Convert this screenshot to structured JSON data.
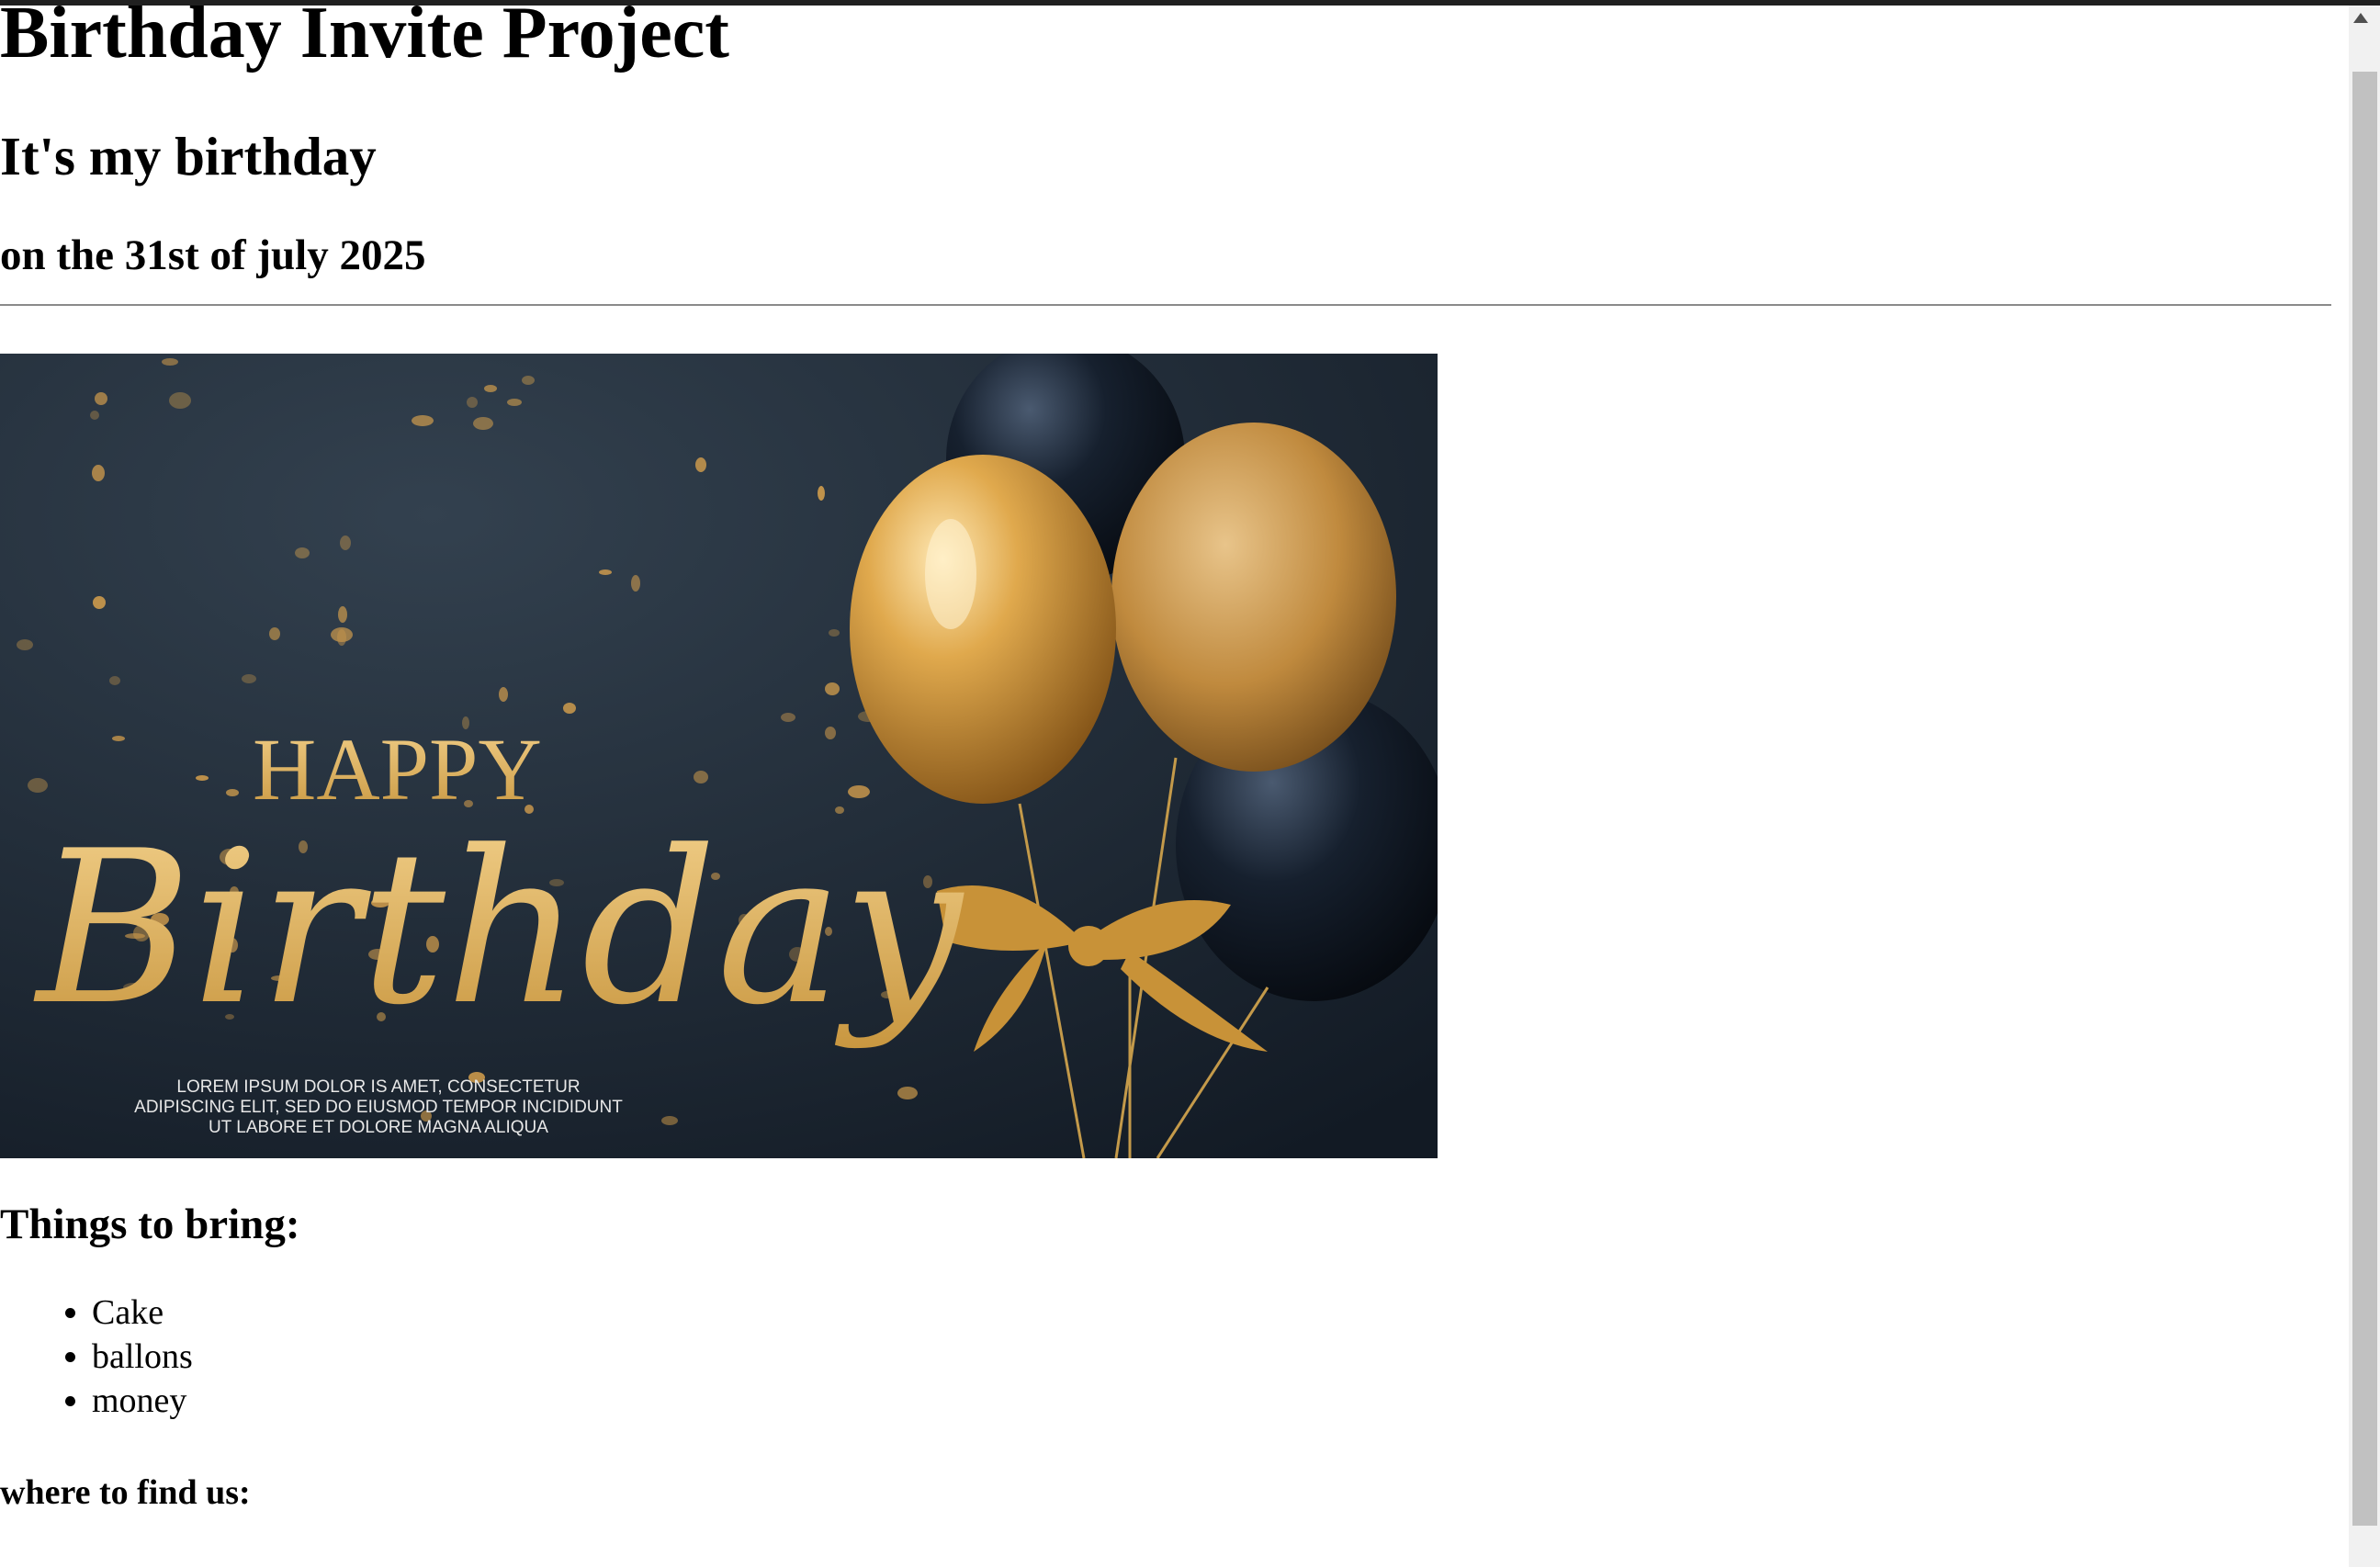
{
  "page": {
    "title": "Birthday Invite Project",
    "subtitle": "It's my birthday",
    "date_line": "on the 31st of july 2025"
  },
  "hero_image": {
    "happy_text": "HAPPY",
    "birthday_text": "Birthday",
    "caption_lines": [
      "LOREM IPSUM DOLOR IS AMET, CONSECTETUR",
      "ADIPISCING ELIT, SED DO EIUSMOD TEMPOR INCIDIDUNT",
      "UT LABORE ET DOLORE MAGNA ALIQUA"
    ]
  },
  "bring": {
    "heading": "Things to bring:",
    "items": [
      "Cake",
      "ballons",
      "money"
    ]
  },
  "location": {
    "heading": "where to find us:"
  },
  "colors": {
    "background": "#ffffff",
    "text": "#000000",
    "gold": "#d4a24a",
    "dark_navy": "#1c2531"
  },
  "icons": {
    "scroll_up": "scroll-up-arrow-icon"
  }
}
